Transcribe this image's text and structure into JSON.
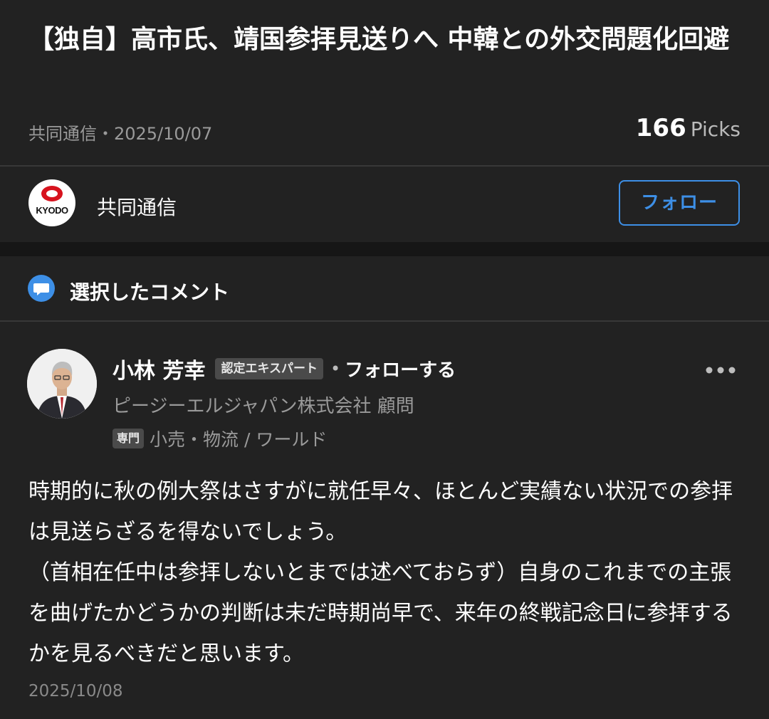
{
  "article": {
    "title": "【独自】高市氏、靖国参拝見送りへ 中韓との外交問題化回避",
    "source_date": "共同通信・2025/10/07",
    "picks_count": "166",
    "picks_label": "Picks"
  },
  "publisher": {
    "logo_text": "KYODO",
    "name": "共同通信",
    "follow_label": "フォロー",
    "accent_color": "#3d8fe6"
  },
  "comments_section": {
    "title": "選択したコメント",
    "icon": "speech-bubble-icon"
  },
  "comment": {
    "author_name": "小林 芳幸",
    "badge": "認定エキスパート",
    "separator": "•",
    "follow_label": "フォローする",
    "company": "ピージーエルジャパン株式会社 顧問",
    "specialty_tag": "専門",
    "specialty": "小売・物流 / ワールド",
    "body": "時期的に秋の例大祭はさすがに就任早々、ほとんど実績ない状況での参拝は見送らざるを得ないでしょう。\n（首相在任中は参拝しないとまでは述べておらず）自身のこれまでの主張を曲げたかどうかの判断は未だ時期尚早で、来年の終戦記念日に参拝するかを見るべきだと思います。",
    "date": "2025/10/08",
    "more_icon": "more-horizontal-icon"
  }
}
